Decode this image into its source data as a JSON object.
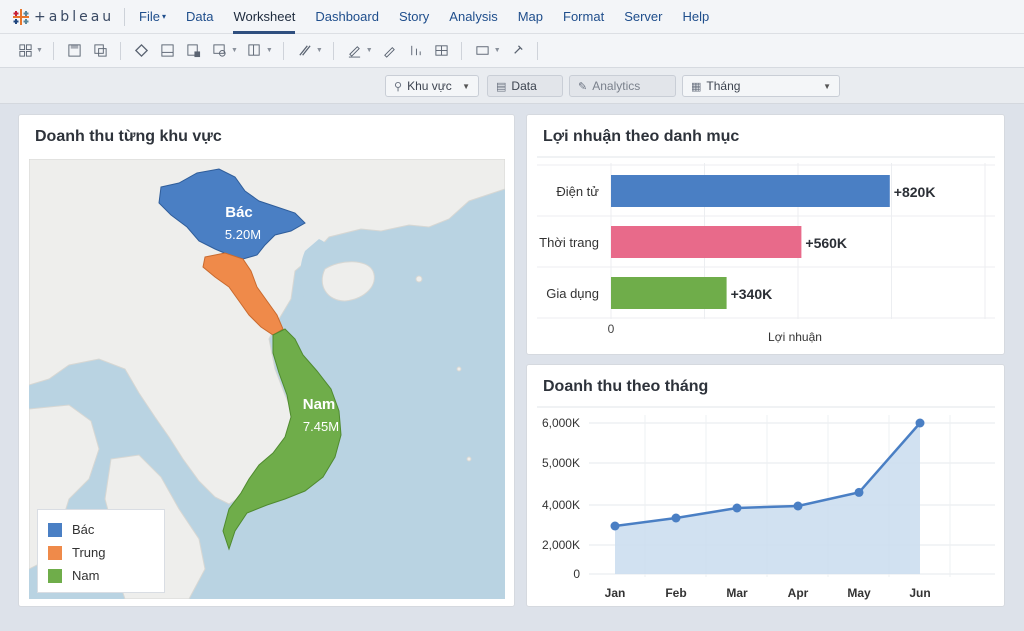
{
  "app": {
    "logo_text": "+ableau"
  },
  "menu": [
    {
      "label": "File",
      "has_caret": true,
      "active": false
    },
    {
      "label": "Data",
      "has_caret": false,
      "active": false
    },
    {
      "label": "Worksheet",
      "has_caret": false,
      "active": true
    },
    {
      "label": "Dashboard",
      "has_caret": false,
      "active": false
    },
    {
      "label": "Story",
      "has_caret": false,
      "active": false
    },
    {
      "label": "Analysis",
      "has_caret": false,
      "active": false
    },
    {
      "label": "Map",
      "has_caret": false,
      "active": false
    },
    {
      "label": "Format",
      "has_caret": false,
      "active": false
    },
    {
      "label": "Server",
      "has_caret": false,
      "active": false
    },
    {
      "label": "Help",
      "has_caret": false,
      "active": false
    }
  ],
  "toolbar_icons": [
    "grid-icon",
    "save-icon",
    "duplicate-icon",
    "tag-icon",
    "sheet-icon",
    "new-sheet-icon",
    "filter-icon",
    "layout-icon",
    "highlight-icon",
    "pen-icon",
    "pencil-icon",
    "sort-icon",
    "table-icon",
    "frame-icon",
    "pin-icon"
  ],
  "shelf": {
    "khu_vuc": "Khu vực",
    "data": "Data",
    "analytics": "Analytics",
    "thang": "Tháng"
  },
  "map_panel": {
    "title": "Doanh thu từng khu vực",
    "labels": {
      "bac_name": "Bác",
      "bac_value": "5.20M",
      "nam_name": "Nam",
      "nam_value": "7.45M"
    },
    "legend": [
      {
        "label": "Bác",
        "color": "#4a7fc4"
      },
      {
        "label": "Trung",
        "color": "#ef8a4a"
      },
      {
        "label": "Nam",
        "color": "#6fad4a"
      }
    ]
  },
  "chart_data": [
    {
      "type": "bar",
      "title": "Lợi nhuận theo danh mục",
      "orientation": "horizontal",
      "categories": [
        "Điện tử",
        "Thời trang",
        "Gia dụng"
      ],
      "values": [
        820000,
        560000,
        340000
      ],
      "data_labels": [
        "+820K",
        "+560K",
        "+340K"
      ],
      "colors": [
        "#4a7fc4",
        "#e86a8a",
        "#6fad4a"
      ],
      "xlabel": "Lợi nhuận",
      "x_tick_labels": [
        "0"
      ],
      "xlim": [
        0,
        1100000
      ],
      "grid": true
    },
    {
      "type": "area",
      "title": "Doanh thu theo tháng",
      "categories": [
        "Jan",
        "Feb",
        "Mar",
        "Apr",
        "May",
        "Jun"
      ],
      "values": [
        2950,
        3350,
        3850,
        3950,
        4300,
        6000
      ],
      "unit": "K",
      "y_ticks": [
        0,
        2000,
        4000,
        5000,
        6000
      ],
      "y_tick_labels": [
        "0",
        "2,000K",
        "4,000K",
        "5,000K",
        "6,000K"
      ],
      "color": "#4a7fc4",
      "grid": true
    }
  ]
}
